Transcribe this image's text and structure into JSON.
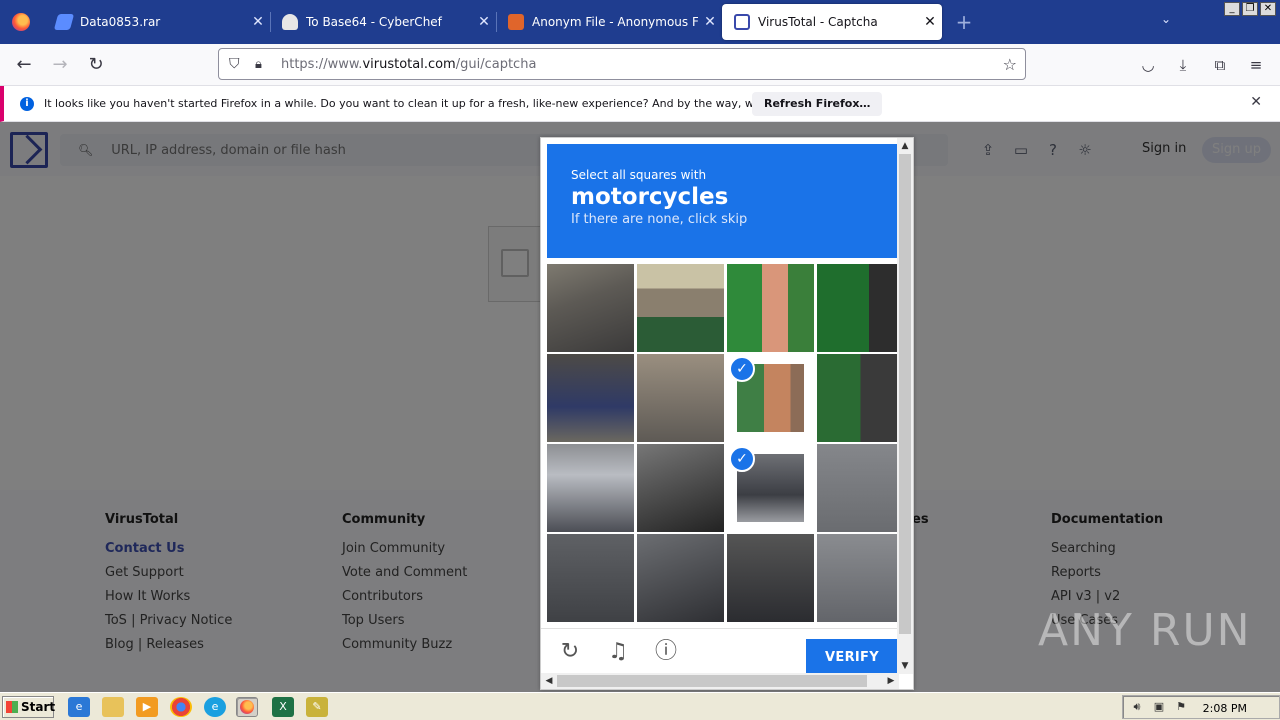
{
  "browser": {
    "tabs": [
      {
        "title": "Data0853.rar",
        "icon": "download-file-icon",
        "icon_color": "#5b8cff",
        "active": false
      },
      {
        "title": "To Base64 - CyberChef",
        "icon": "chef-hat-icon",
        "icon_color": "#e6e6e6",
        "active": false
      },
      {
        "title": "Anonym File - Anonymous File Uplo",
        "icon": "anonymfile-icon",
        "icon_color": "#e0652b",
        "active": false
      },
      {
        "title": "VirusTotal - Captcha",
        "icon": "virustotal-icon",
        "icon_color": "#3949ab",
        "active": true
      }
    ],
    "url": {
      "prefix": "https://www.",
      "host": "virustotal.com",
      "path": "/gui/captcha"
    },
    "window_buttons": {
      "minimize": "_",
      "restore": "❐",
      "close": "✕"
    }
  },
  "notification": {
    "text": "It looks like you haven't started Firefox in a while. Do you want to clean it up for a fresh, like-new experience? And by the way, welcome back!",
    "button": "Refresh Firefox…"
  },
  "virustotal": {
    "search_placeholder": "URL, IP address, domain or file hash",
    "signin": "Sign in",
    "signup": "Sign up"
  },
  "footer": {
    "columns": [
      {
        "heading": "VirusTotal",
        "items": [
          "Contact Us",
          "Get Support",
          "How It Works",
          "ToS | Privacy Notice",
          "Blog | Releases"
        ]
      },
      {
        "heading": "Community",
        "items": [
          "Join Community",
          "Vote and Comment",
          "Contributors",
          "Top Users",
          "Community Buzz"
        ]
      },
      {
        "heading": "es",
        "items": []
      },
      {
        "heading": "Documentation",
        "items": [
          "Searching",
          "Reports",
          "API v3 | v2",
          "Use Cases"
        ]
      }
    ]
  },
  "captcha": {
    "line1": "Select all squares with",
    "target": "motorcycles",
    "line3": "If there are none, click skip",
    "verify": "VERIFY",
    "selected_cells": [
      6,
      10
    ],
    "header_color": "#1a73e8"
  },
  "watermark": "ANY RUN",
  "taskbar": {
    "start": "Start",
    "clock": "2:08 PM"
  }
}
